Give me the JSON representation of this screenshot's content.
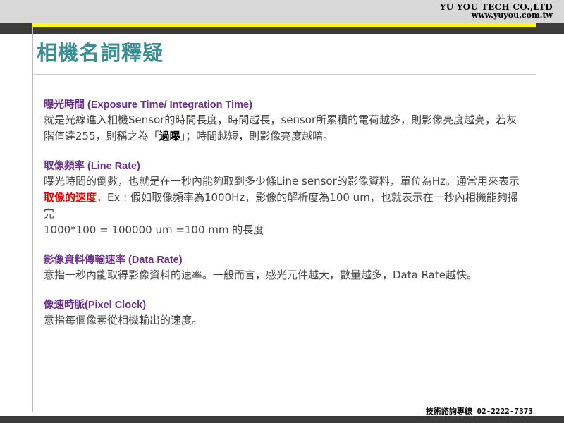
{
  "header": {
    "company_name": "YU YOU TECH CO.,LTD",
    "company_url": "www.yuyou.com.tw"
  },
  "page": {
    "title": "相機名詞釋疑"
  },
  "sections": [
    {
      "title": "曝光時間 (Exposure Time/ Integration Time)",
      "p1": "就是光線進入相機Sensor的時間長度，時間越長，sensor所累積的電荷越多，則影像亮度越亮，若灰階值達255，則稱之為「",
      "bold": "過曝",
      "p2": "」；時間越短，則影像亮度越暗。"
    },
    {
      "title": "取像頻率 (Line Rate)",
      "p1": "曝光時間的倒數，也就是在一秒內能夠取到多少條Line sensor的影像資料，單位為Hz。通常用來表示",
      "highlight": "取像的速度",
      "p2": "，Ex : 假如取像頻率為1000Hz，影像的解析度為100 um，也就表示在一秒內相機能夠掃完",
      "formula": "1000*100 = 100000 um =100 mm 的長度"
    },
    {
      "title": "影像資料傳輸速率 (Data Rate)",
      "body": "意指一秒內能取得影像資料的速率。一般而言，感光元件越大，數量越多，Data Rate越快。"
    },
    {
      "title": "像速時脈(Pixel Clock)",
      "body": "意指每個像素從相機輸出的速度。"
    }
  ],
  "footer": {
    "contact": "技術諮詢專線 02-2222-7373"
  },
  "colors": {
    "title": "#3a8f92",
    "section_title": "#6a2f86",
    "highlight_red": "#e00000",
    "accent_yellow": "#ffff00",
    "band_dark": "#3b3b3b",
    "band_light": "#d8d8d8"
  }
}
